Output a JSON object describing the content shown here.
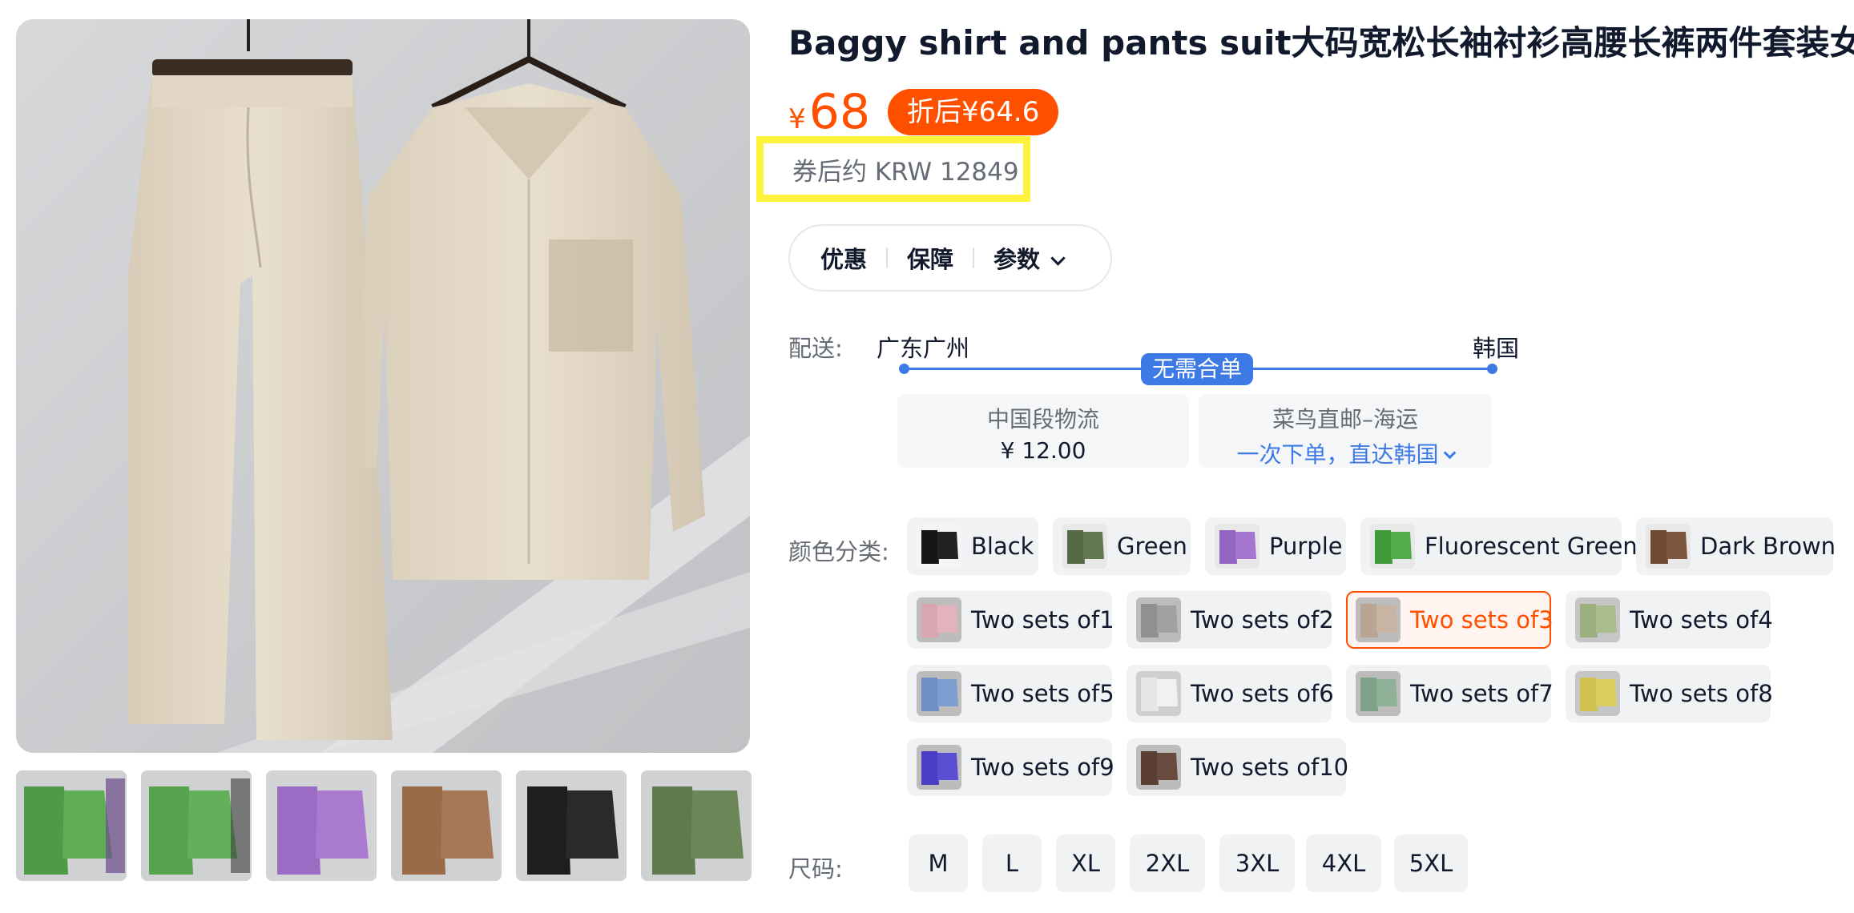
{
  "product": {
    "title": "Baggy shirt and pants suit大码宽松长袖衬衫高腰长裤两件套装女",
    "price_symbol": "¥",
    "price": "68",
    "discount_badge": "折后¥64.6",
    "krw_estimate": "券后约 KRW 12849",
    "highlight_color": "#fff23b",
    "accent_color": "#ff5000"
  },
  "tabs": {
    "promo": "优惠",
    "guarantee": "保障",
    "params": "参数"
  },
  "delivery": {
    "label": "配送:",
    "from": "广东广州",
    "to": "韩国",
    "badge": "无需合单",
    "domestic_title": "中国段物流",
    "domestic_price": "¥ 12.00",
    "intl_title": "菜鸟直邮–海运",
    "intl_link": "一次下单，直达韩国",
    "route_color": "#3d7ae6"
  },
  "colors": {
    "label": "颜色分类:",
    "options": [
      {
        "label": "Black",
        "selected": false
      },
      {
        "label": "Green",
        "selected": false
      },
      {
        "label": "Purple",
        "selected": false
      },
      {
        "label": "Fluorescent Green",
        "selected": false
      },
      {
        "label": "Dark Brown",
        "selected": false
      },
      {
        "label": "Two sets of1",
        "selected": false
      },
      {
        "label": "Two sets of2",
        "selected": false
      },
      {
        "label": "Two sets of3",
        "selected": true
      },
      {
        "label": "Two sets of4",
        "selected": false
      },
      {
        "label": "Two sets of5",
        "selected": false
      },
      {
        "label": "Two sets of6",
        "selected": false
      },
      {
        "label": "Two sets of7",
        "selected": false
      },
      {
        "label": "Two sets of8",
        "selected": false
      },
      {
        "label": "Two sets of9",
        "selected": false
      },
      {
        "label": "Two sets of10",
        "selected": false
      }
    ]
  },
  "sizes": {
    "label": "尺码:",
    "options": [
      "M",
      "L",
      "XL",
      "2XL",
      "3XL",
      "4XL",
      "5XL"
    ]
  },
  "gallery": {
    "main_image": "beige-shirt-and-pants-on-hangers",
    "thumbnails": [
      "green-set-photo",
      "green-set-photo-2",
      "purple-set-photo",
      "brown-set-photo",
      "black-set-photo",
      "olive-set-photo"
    ]
  }
}
